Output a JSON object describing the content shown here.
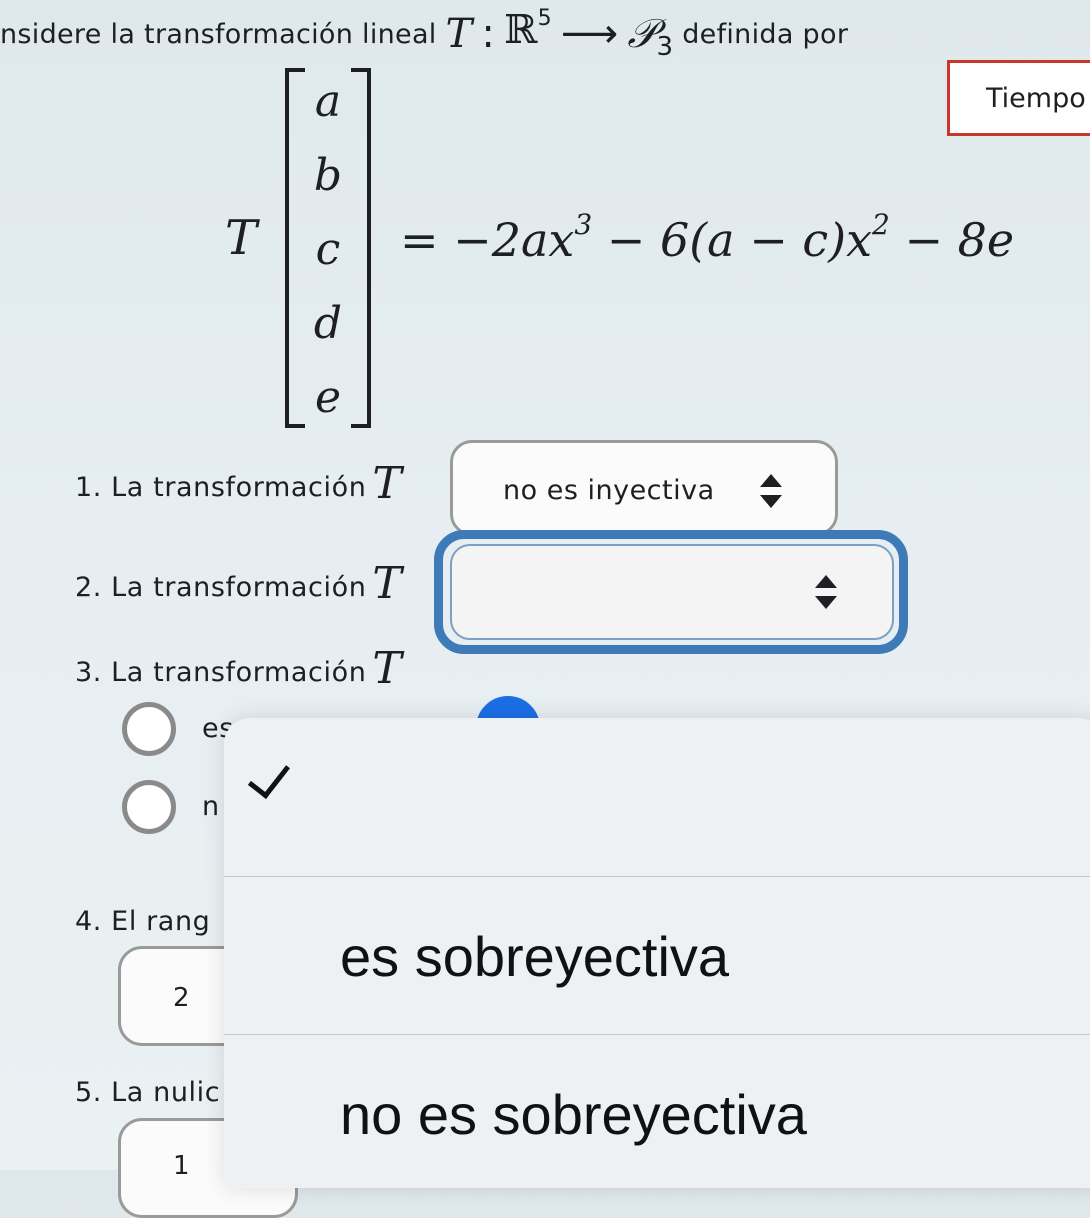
{
  "problem": {
    "intro_text": "nsidere la transformación lineal",
    "map_lhs": "T",
    "map_colon": ":",
    "domain_space": "ℝ",
    "domain_dim": "5",
    "arrow": "⟶",
    "codomain_space": "𝒫",
    "codomain_index": "3",
    "intro_suffix": "definida por",
    "T_symbol": "T",
    "vector": [
      "a",
      "b",
      "c",
      "d",
      "e"
    ],
    "rhs_part1": "= −2ax",
    "rhs_exp1": "3",
    "rhs_part2": " − 6(a − c)x",
    "rhs_exp2": "2",
    "rhs_part3": " − 8e"
  },
  "timer": {
    "label": "Tiempo"
  },
  "questions": [
    {
      "number": "1.",
      "text": "La transformación",
      "var": "T",
      "selected": "no es inyectiva"
    },
    {
      "number": "2.",
      "text": "La transformación",
      "var": "T",
      "selected": ""
    },
    {
      "number": "3.",
      "text": "La transformación",
      "var": "T",
      "radio_options": [
        "es",
        "n"
      ]
    },
    {
      "number": "4.",
      "text": "El rang",
      "answer": "2"
    },
    {
      "number": "5.",
      "text": "La nulic",
      "answer": "1"
    }
  ],
  "picker": {
    "options": [
      "",
      "es sobreyectiva",
      "no es sobreyectiva"
    ],
    "selected_index": 0
  }
}
